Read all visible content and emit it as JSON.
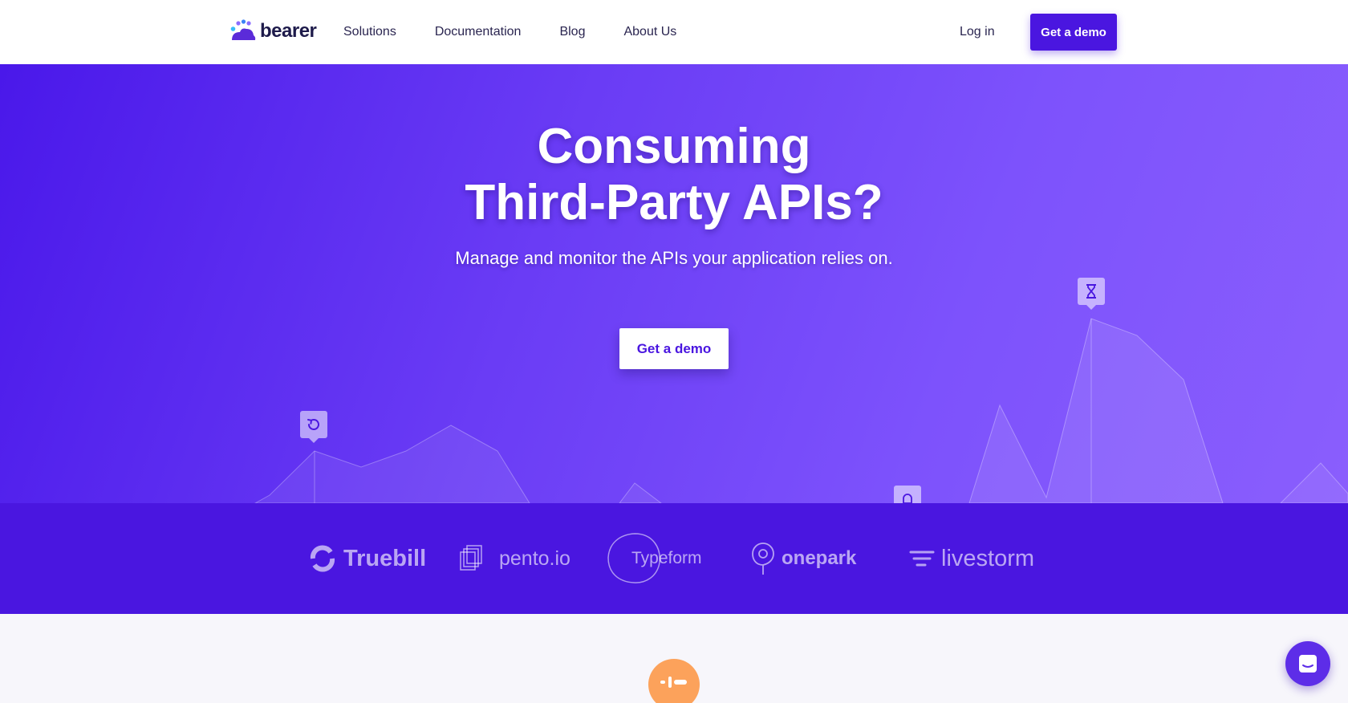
{
  "nav": {
    "logo_text": "bearer",
    "links": [
      {
        "label": "Solutions"
      },
      {
        "label": "Documentation"
      },
      {
        "label": "Blog"
      },
      {
        "label": "About Us"
      }
    ],
    "login_label": "Log in",
    "cta_label": "Get a demo"
  },
  "hero": {
    "title_line1": "Consuming",
    "title_line2": "Third-Party APIs?",
    "subtitle": "Manage and monitor the APIs your application relies on.",
    "cta_label": "Get a demo",
    "markers": [
      "refresh-icon",
      "hourglass-icon",
      "bell-icon"
    ]
  },
  "clients": [
    "Truebill",
    "pento.io",
    "Typeform",
    "onepark",
    "livestorm"
  ],
  "lower": {
    "badge_icon": "feature-icon"
  },
  "colors": {
    "brand": "#4a16e0",
    "accent_orange": "#fca25b",
    "nav_text": "#2a2550"
  }
}
